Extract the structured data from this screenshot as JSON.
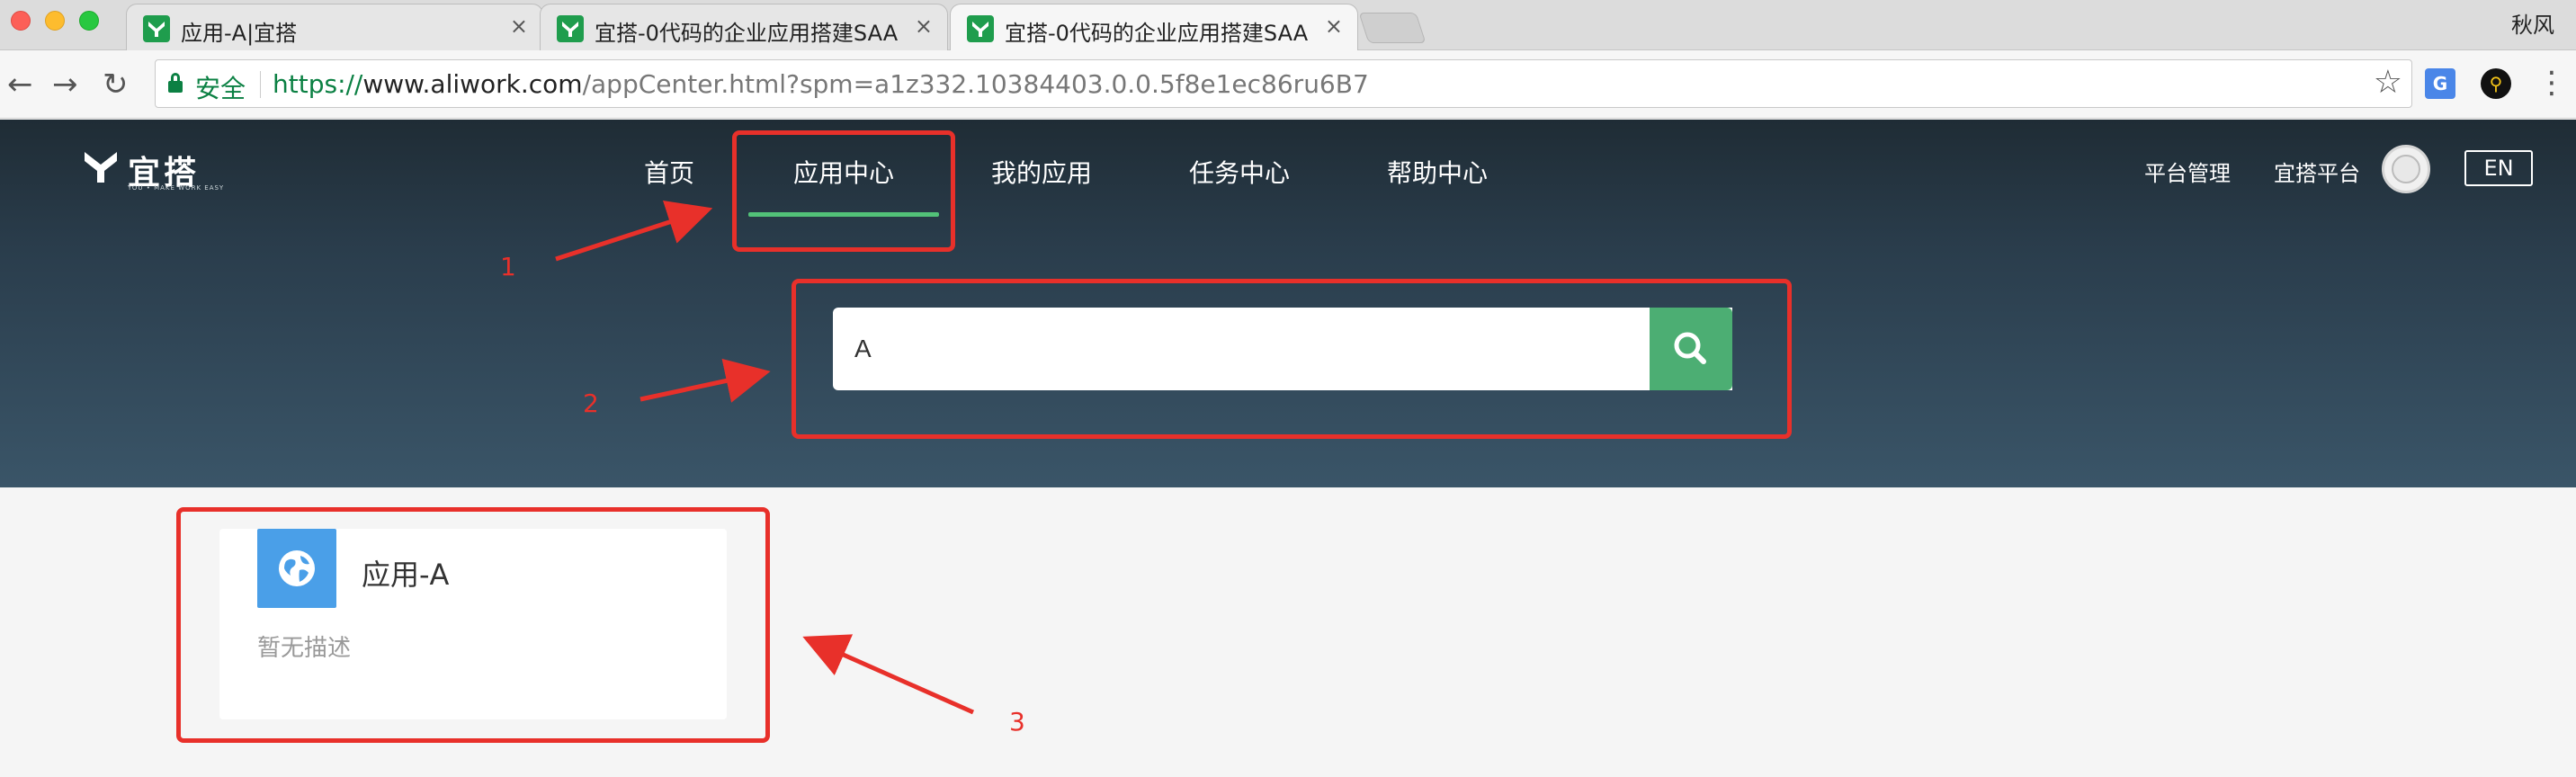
{
  "browser": {
    "tabs": [
      {
        "title": "应用-A|宜搭",
        "close": "×"
      },
      {
        "title": "宜搭-0代码的企业应用搭建SAA",
        "close": "×"
      },
      {
        "title": "宜搭-0代码的企业应用搭建SAA",
        "close": "×"
      }
    ],
    "profile_name": "秋风",
    "back": "←",
    "forward": "→",
    "reload": "↻",
    "secure_label": "安全",
    "url_scheme": "https://",
    "url_host": "www.aliwork.com",
    "url_path": "/appCenter.html?spm=a1z332.10384403.0.0.5f8e1ec86ru6B7",
    "star": "☆",
    "ext_translate": "G",
    "ext_key": "⚲",
    "menu": "⋮"
  },
  "site": {
    "logo_text": "宜搭",
    "logo_tagline": "YOU • MAKE WORK EASY",
    "nav": [
      "首页",
      "应用中心",
      "我的应用",
      "任务中心",
      "帮助中心"
    ],
    "active_nav": "应用中心",
    "platform_admin": "平台管理",
    "platform_name": "宜搭平台",
    "lang_button": "EN",
    "accent_color": "#52c178"
  },
  "search": {
    "value": "A",
    "button_color": "#4cae73"
  },
  "apps": [
    {
      "name": "应用-A",
      "description": "暂无描述",
      "icon": "globe-icon",
      "icon_color": "#4a9fe8"
    }
  ],
  "annotations": {
    "labels": [
      "1",
      "2",
      "3"
    ],
    "color": "#e8302a"
  }
}
